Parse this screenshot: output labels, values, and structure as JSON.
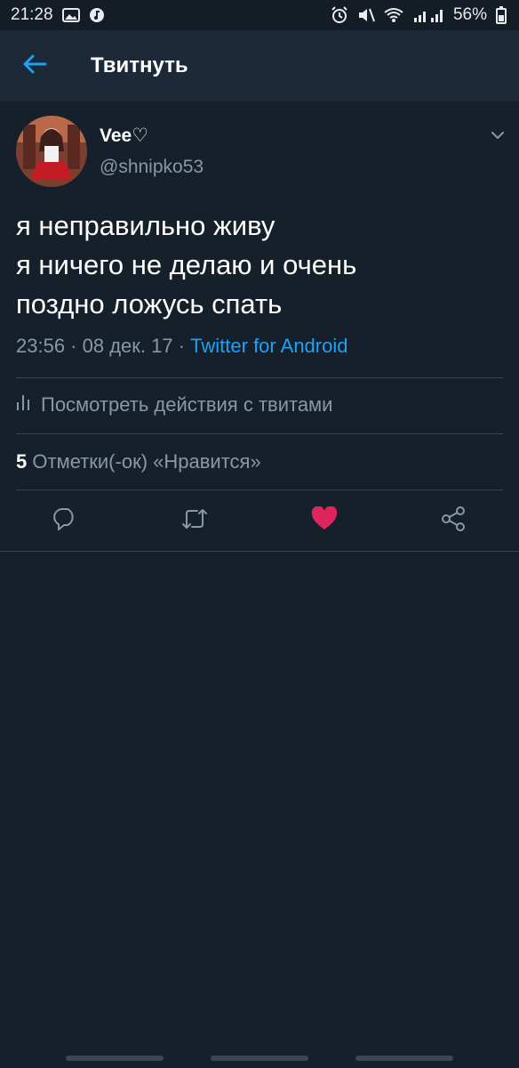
{
  "status_bar": {
    "time": "21:28",
    "battery": "56%"
  },
  "header": {
    "title": "Твитнуть"
  },
  "tweet": {
    "author_name": "Vee♡",
    "author_handle": "@shnipko53",
    "text_lines": [
      "я неправильно живу",
      "я ничего не делаю и очень",
      "поздно ложусь спать"
    ],
    "time": "23:56",
    "separator": " · ",
    "date": "08 дек. 17",
    "source": "Twitter for Android"
  },
  "activity_link": "Посмотреть действия с твитами",
  "likes": {
    "count": "5",
    "label": "Отметки(-ок) «Нравится»"
  },
  "colors": {
    "background": "#15202b",
    "header_bg": "#1c2938",
    "accent": "#1da1f2",
    "like": "#e0245e",
    "muted_text": "#8899a6"
  },
  "icons": {
    "back": "arrow-left-icon",
    "caret": "chevron-down-icon",
    "activity": "bar-chart-icon",
    "reply": "reply-icon",
    "retweet": "retweet-icon",
    "like": "heart-filled-icon",
    "share": "share-icon"
  }
}
